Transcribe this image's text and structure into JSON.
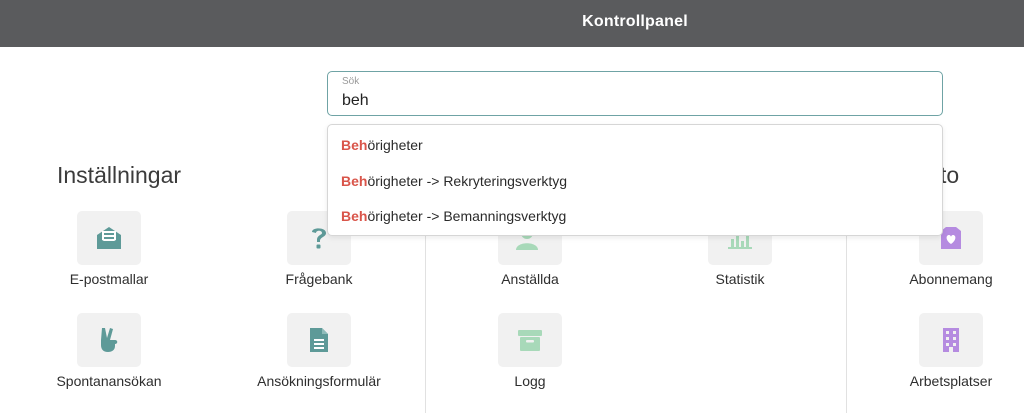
{
  "header": {
    "title": "Kontrollpanel"
  },
  "search": {
    "label": "Sök",
    "value": "beh",
    "suggestions": [
      {
        "match": "Beh",
        "rest": "örigheter"
      },
      {
        "match": "Beh",
        "rest": "örigheter -> Rekryteringsverktyg"
      },
      {
        "match": "Beh",
        "rest": "örigheter -> Bemanningsverktyg"
      }
    ]
  },
  "sections": {
    "installningar": {
      "title": "Inställningar",
      "items": [
        {
          "label": "E-postmallar",
          "icon": "envelope-icon"
        },
        {
          "label": "Frågebank",
          "icon": "question-icon"
        },
        {
          "label": "Spontanansökan",
          "icon": "peace-hand-icon"
        },
        {
          "label": "Ansökningsformulär",
          "icon": "document-icon"
        }
      ]
    },
    "middle": {
      "items": [
        {
          "label": "Anställda",
          "icon": "user-add-icon"
        },
        {
          "label": "Statistik",
          "icon": "chart-icon"
        },
        {
          "label": "Logg",
          "icon": "archive-box-icon"
        }
      ]
    },
    "konto": {
      "title_visible": "to",
      "items": [
        {
          "label": "Abonnemang",
          "icon": "subscription-box-icon"
        },
        {
          "label": "Arbetsplatser",
          "icon": "building-icon"
        }
      ]
    }
  },
  "colors": {
    "header_bg": "#5a5b5d",
    "icon_teal": "#5e9a98",
    "icon_green": "#a8d9b9",
    "icon_purple": "#b58be0",
    "highlight": "#d9554a",
    "search_border": "#6fa3a5"
  }
}
